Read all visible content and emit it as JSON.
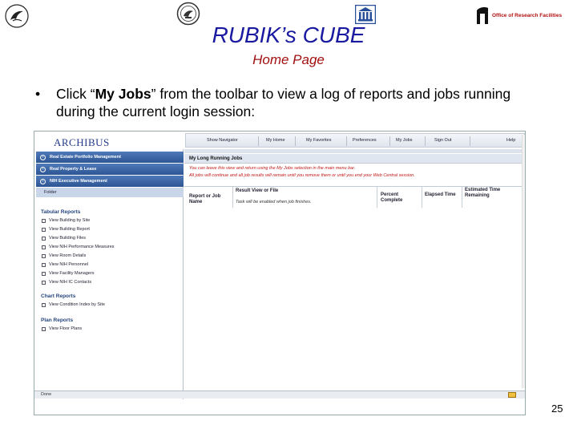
{
  "slide": {
    "title": "RUBIK’s CUBE",
    "subtitle": "Home Page",
    "bullet_symbol": "•",
    "bullet_prefix": "Click “",
    "bullet_bold": "My Jobs",
    "bullet_suffix": "” from the toolbar to view a log of reports and jobs running during the current login session:",
    "page_number": "25",
    "orf_logo_text": "Office of Research Facilities"
  },
  "colors": {
    "title": "#1a1aa0",
    "subtitle": "#a01010",
    "nav_tab": "#2d5594",
    "instruction": "#c01818"
  },
  "app": {
    "logo": "ARCHIBUS",
    "toolbar": [
      {
        "label": "Show Navigator"
      },
      {
        "label": "My Home"
      },
      {
        "label": "My Favorites"
      },
      {
        "label": "Preferences"
      },
      {
        "label": "My Jobs"
      },
      {
        "label": "Sign Out"
      },
      {
        "label": "Help"
      }
    ],
    "nav_tabs": [
      {
        "label": "Real Estate Portfolio Management"
      },
      {
        "label": "Real Property & Lease"
      },
      {
        "label": "NIH Executive Management"
      }
    ],
    "folder_label": "Folder",
    "sections": [
      {
        "heading": "Tabular Reports",
        "tasks": [
          "View Building by Site",
          "View Building Report",
          "View Building Files",
          "View NIH Performance Measures",
          "View Room Details",
          "View NIH Personnel",
          "View Facility Managers",
          "View NIH IC Contacts"
        ]
      },
      {
        "heading": "Chart Reports",
        "tasks": [
          "View Condition Index by Site"
        ]
      },
      {
        "heading": "Plan Reports",
        "tasks": [
          "View Floor Plans"
        ]
      }
    ],
    "jobs_panel": {
      "title": "My Long Running Jobs",
      "instruction_1": "You can leave this view and return using the My Jobs selection in the main menu bar.",
      "instruction_2": "All jobs will continue and all job results will remain until you remove them or until you end your Web Central session.",
      "columns": [
        "Report or Job Name",
        "Result View or File",
        "Percent Complete",
        "Elapsed Time",
        "Estimated Time Remaining"
      ],
      "empty_message": "Task will be enabled when job finishes."
    },
    "status_text": "Done"
  }
}
